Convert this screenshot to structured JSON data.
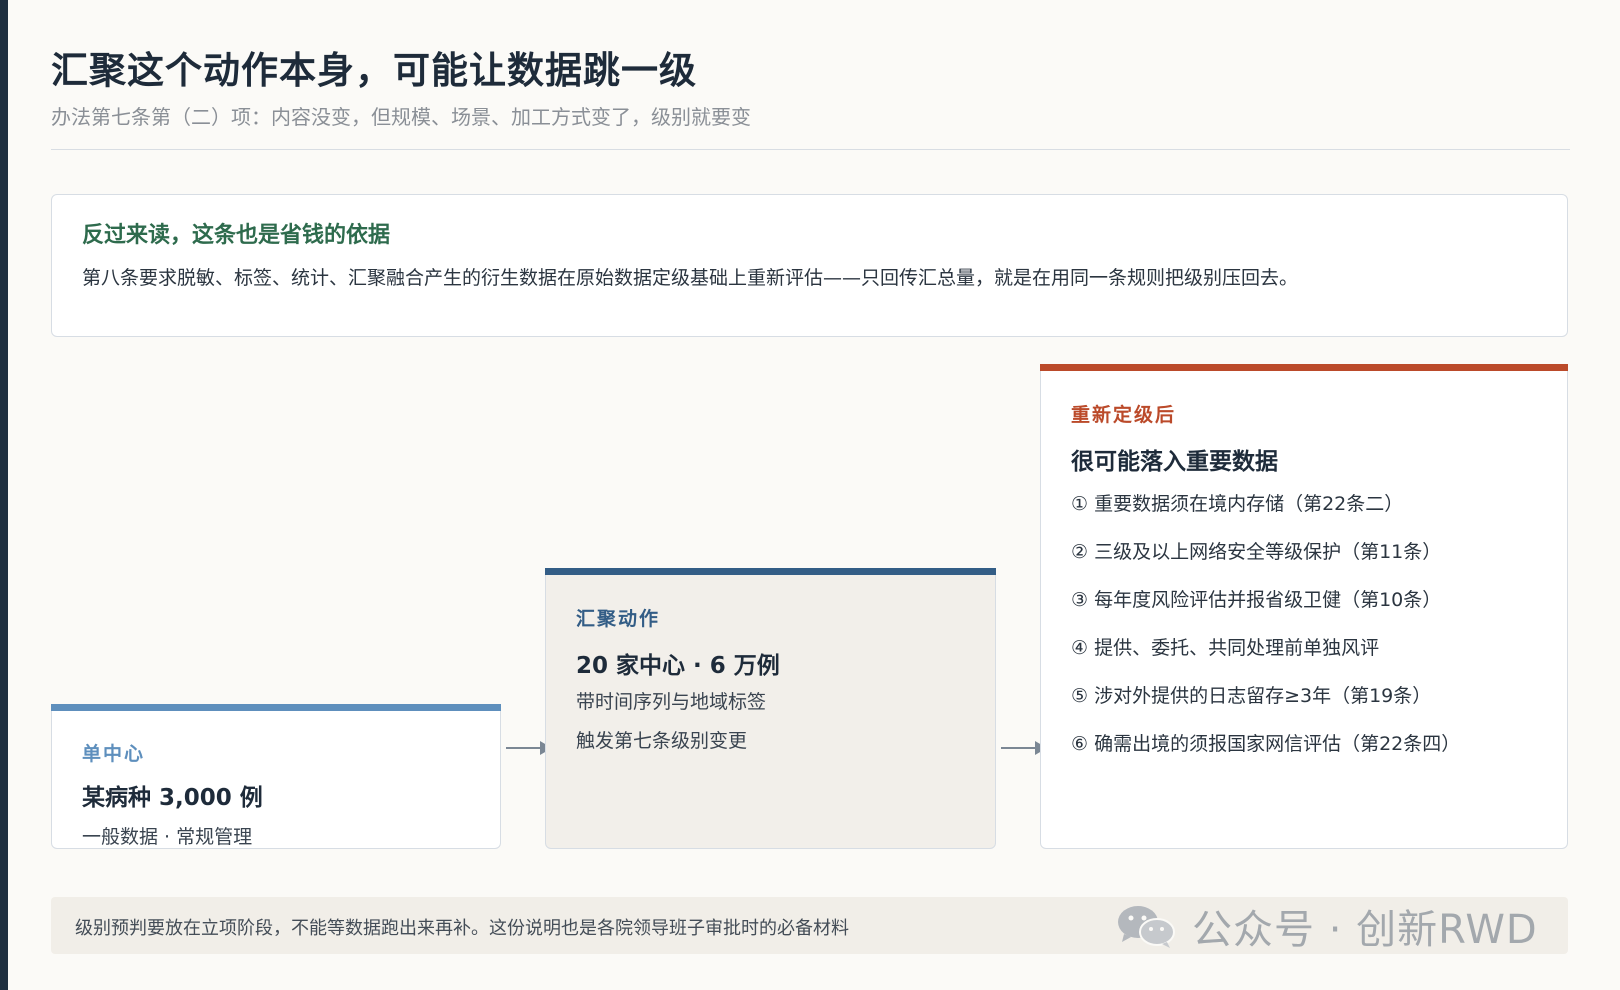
{
  "header": {
    "title": "汇聚这个动作本身，可能让数据跳一级",
    "subtitle": "办法第七条第（二）项：内容没变，但规模、场景、加工方式变了，级别就要变"
  },
  "note": {
    "title": "反过来读，这条也是省钱的依据",
    "body": "第八条要求脱敏、标签、统计、汇聚融合产生的衍生数据在原始数据定级基础上重新评估——只回传汇总量，就是在用同一条规则把级别压回去。"
  },
  "flow": {
    "card1": {
      "kicker": "单中心",
      "headline": "某病种 3,000 例",
      "line": "一般数据 · 常规管理"
    },
    "card2": {
      "kicker": "汇聚动作",
      "headline": "20 家中心 · 6 万例",
      "line1": "带时间序列与地域标签",
      "line2": "触发第七条级别变更"
    },
    "card3": {
      "kicker": "重新定级后",
      "headline": "很可能落入重要数据",
      "items": [
        "① 重要数据须在境内存储（第22条二）",
        "② 三级及以上网络安全等级保护（第11条）",
        "③ 每年度风险评估并报省级卫健（第10条）",
        "④ 提供、委托、共同处理前单独风评",
        "⑤ 涉对外提供的日志留存≥3年（第19条）",
        "⑥ 确需出境的须报国家网信评估（第22条四）"
      ]
    }
  },
  "footer": {
    "text": "级别预判要放在立项阶段，不能等数据跑出来再补。这份说明也是各院领导班子审批时的必备材料"
  },
  "watermark": {
    "icon": "wechat-icon",
    "text": "公众号 · 创新RWD"
  },
  "colors": {
    "accent_green": "#2e6b4d",
    "accent_blue_light": "#5e8fbd",
    "accent_blue_dark": "#335d86",
    "accent_red": "#bb4a2a"
  }
}
